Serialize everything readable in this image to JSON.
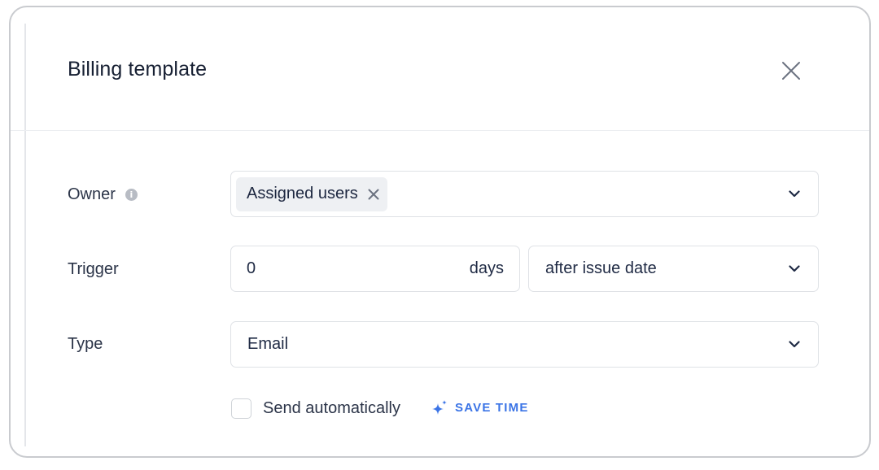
{
  "dialog": {
    "title": "Billing template",
    "close_icon": "close-icon"
  },
  "owner": {
    "label": "Owner",
    "info_icon": "info-icon",
    "chip_label": "Assigned users",
    "chip_remove_icon": "close-icon"
  },
  "trigger": {
    "label": "Trigger",
    "days_value": "0",
    "days_suffix": "days",
    "relation_value": "after issue date"
  },
  "type": {
    "label": "Type",
    "value": "Email"
  },
  "auto_send": {
    "label": "Send automatically",
    "checked": false,
    "hint_icon": "sparkle-icon",
    "hint_label": "SAVE TIME"
  },
  "colors": {
    "accent": "#3b74e6",
    "text": "#1f2a44",
    "border": "#dfe2e6",
    "chip_bg": "#eef0f3"
  }
}
